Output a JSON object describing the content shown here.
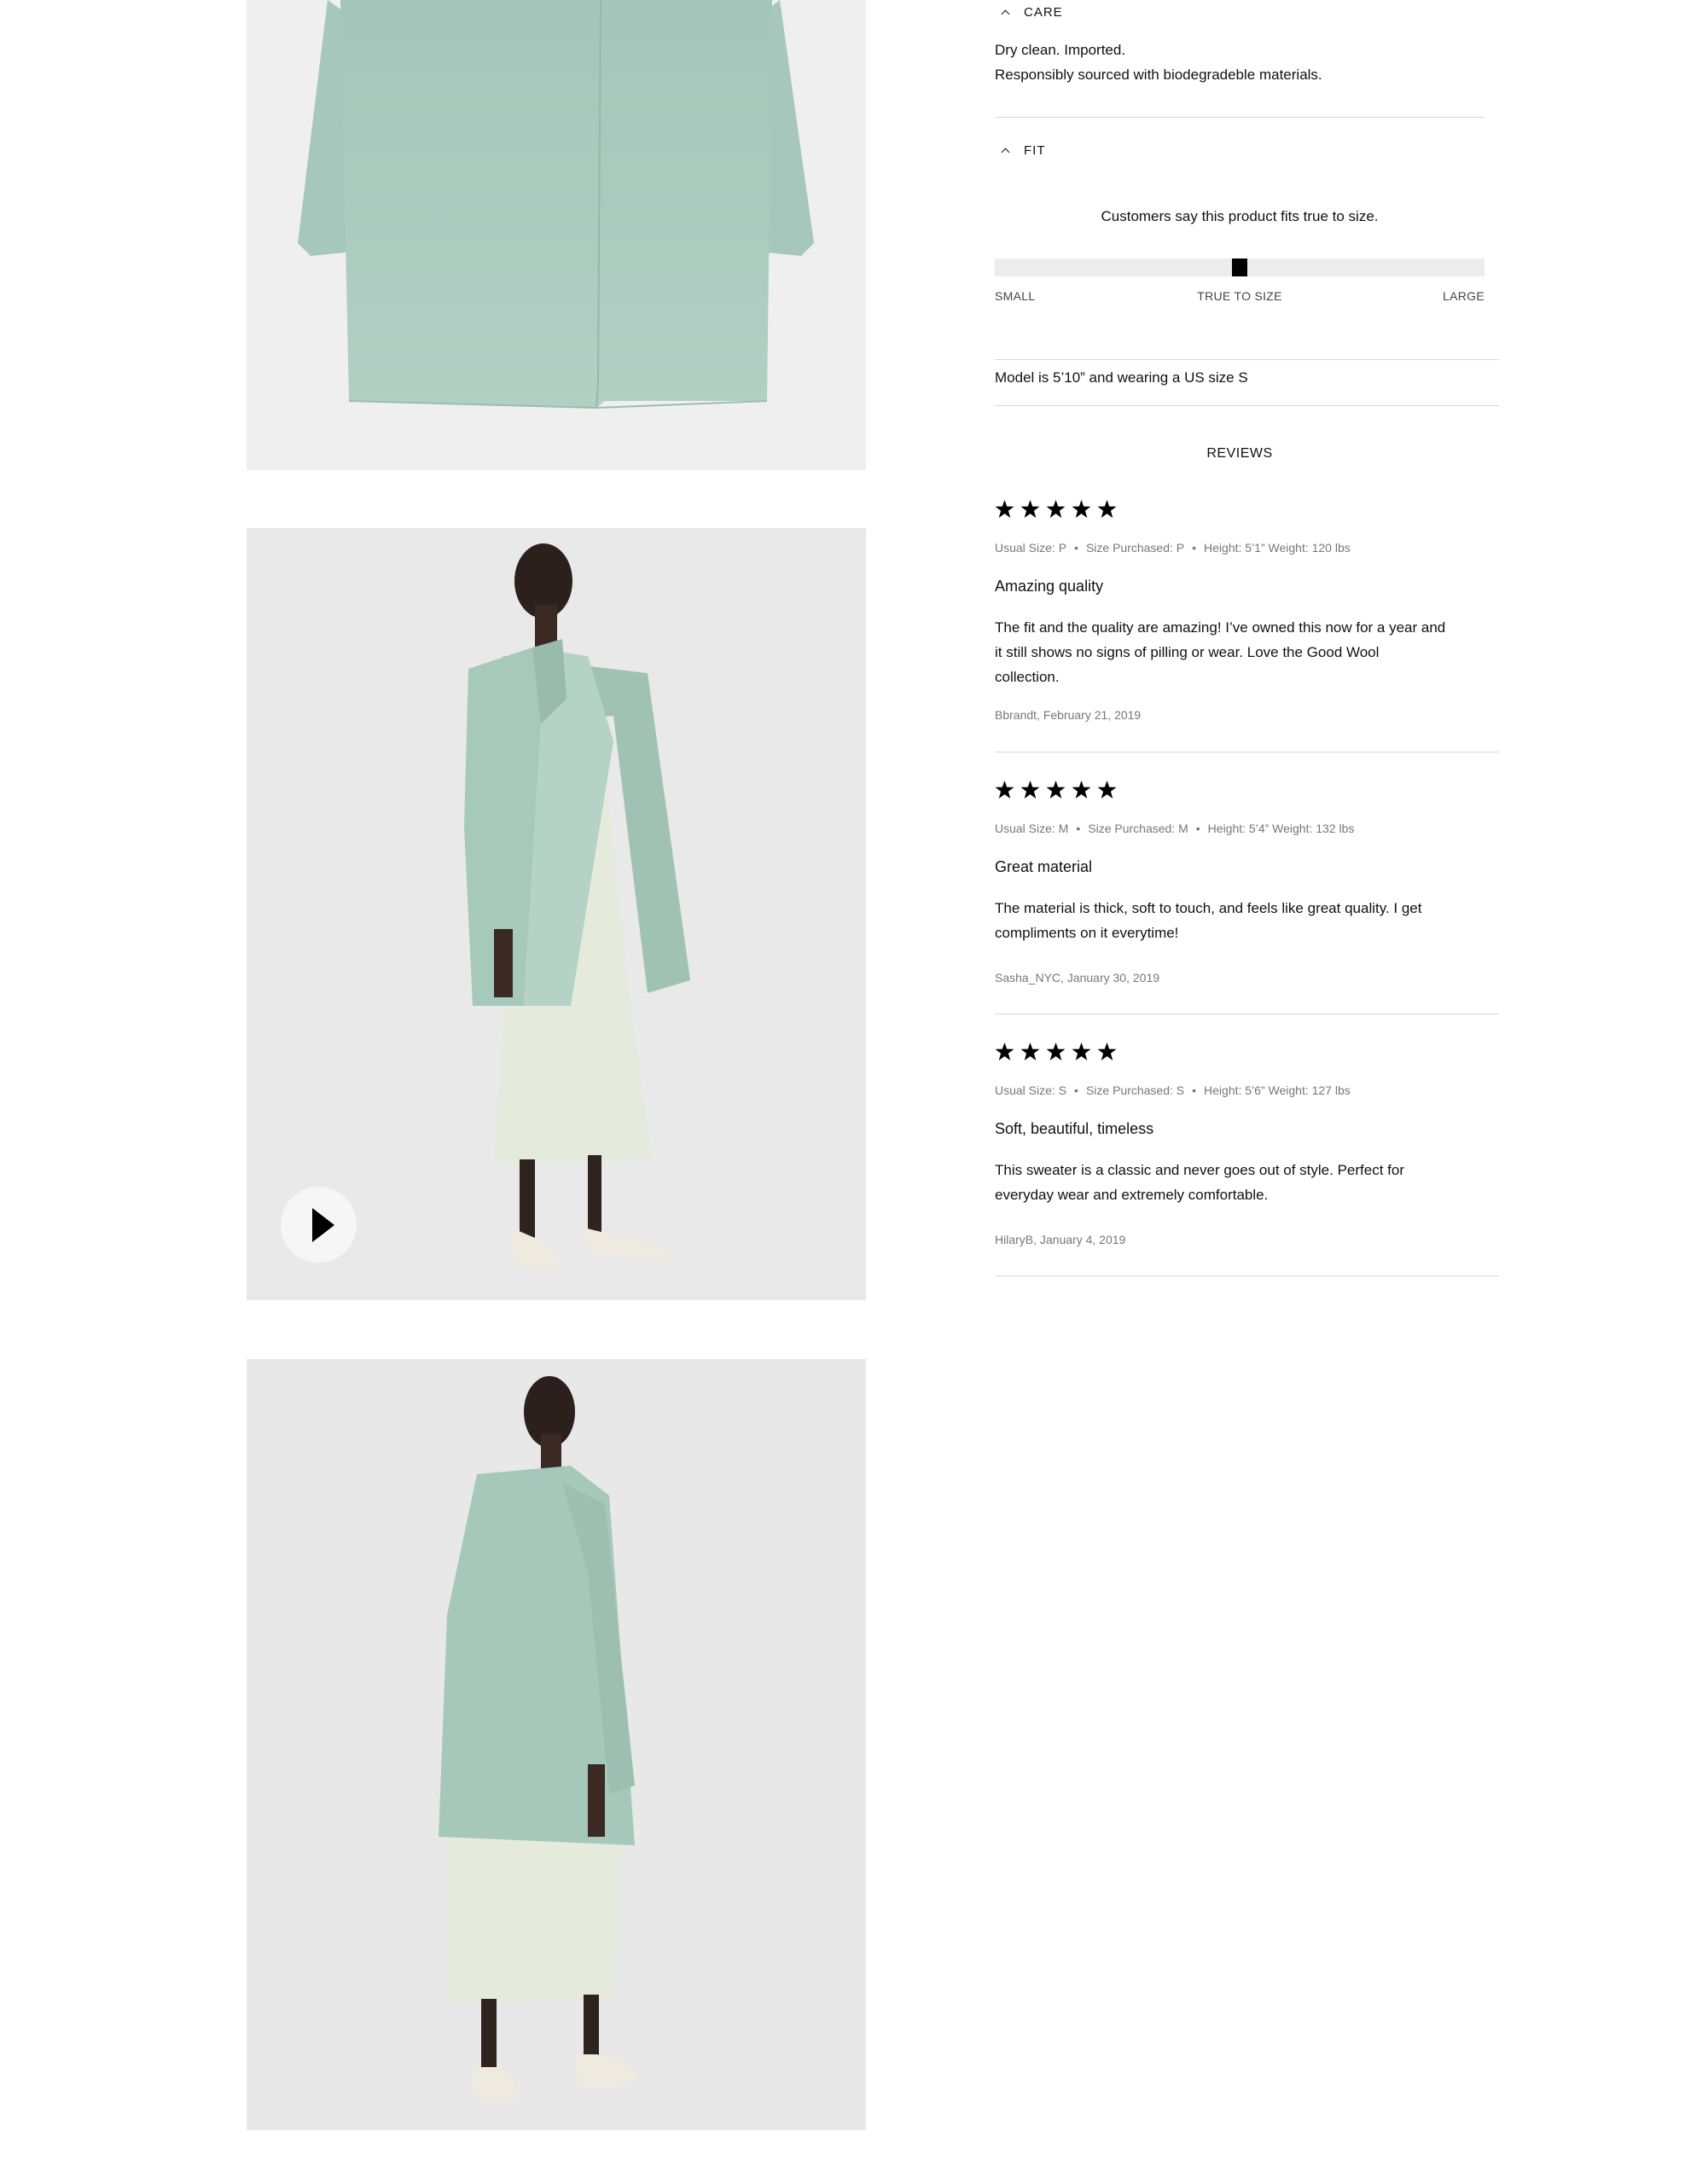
{
  "care": {
    "heading": "CARE",
    "lines": [
      "Dry clean. Imported.",
      "Responsibly sourced with biodegradeble materials."
    ]
  },
  "fit": {
    "heading": "FIT",
    "summary": "Customers say this product fits true to size.",
    "scale_labels": {
      "small": "SMALL",
      "middle": "TRUE TO SIZE",
      "large": "LARGE"
    },
    "indicator_fraction": 0.5,
    "model_note": "Model is 5’10” and wearing a US size S"
  },
  "reviews": {
    "heading": "REVIEWS",
    "items": [
      {
        "rating": 5,
        "usual_size": "Usual Size: P",
        "size_purchased": "Size Purchased: P",
        "height_weight": "Height: 5’1” Weight: 120 lbs",
        "title": "Amazing quality",
        "body": "The fit and the quality are amazing! I’ve owned this now for a year and it still shows no signs of pilling or wear. Love the Good Wool collection.",
        "author_date": "Bbrandt, February 21, 2019"
      },
      {
        "rating": 5,
        "usual_size": "Usual Size: M",
        "size_purchased": "Size Purchased: M",
        "height_weight": "Height: 5’4” Weight: 132 lbs",
        "title": "Great material",
        "body": "The material is thick, soft to touch, and feels like great quality. I get compliments on it everytime!",
        "author_date": "Sasha_NYC, January 30, 2019"
      },
      {
        "rating": 5,
        "usual_size": "Usual Size: S",
        "size_purchased": "Size Purchased: S",
        "height_weight": "Height: 5’6” Weight: 127 lbs",
        "title": "Soft, beautiful, timeless",
        "body": "This sweater is a classic and never goes out of style. Perfect for everyday wear and extremely comfortable.",
        "author_date": "HilaryB, January 4, 2019"
      }
    ]
  },
  "media": {
    "images": [
      "coat-front-flat",
      "model-side-view",
      "model-back-view"
    ],
    "video_button_icon": "play-icon"
  },
  "colors": {
    "coat": "#a9c8bd",
    "dress": "#e3ead9",
    "panel_bg": "#efefef",
    "star": "#000000",
    "divider": "#d9d9d9"
  }
}
